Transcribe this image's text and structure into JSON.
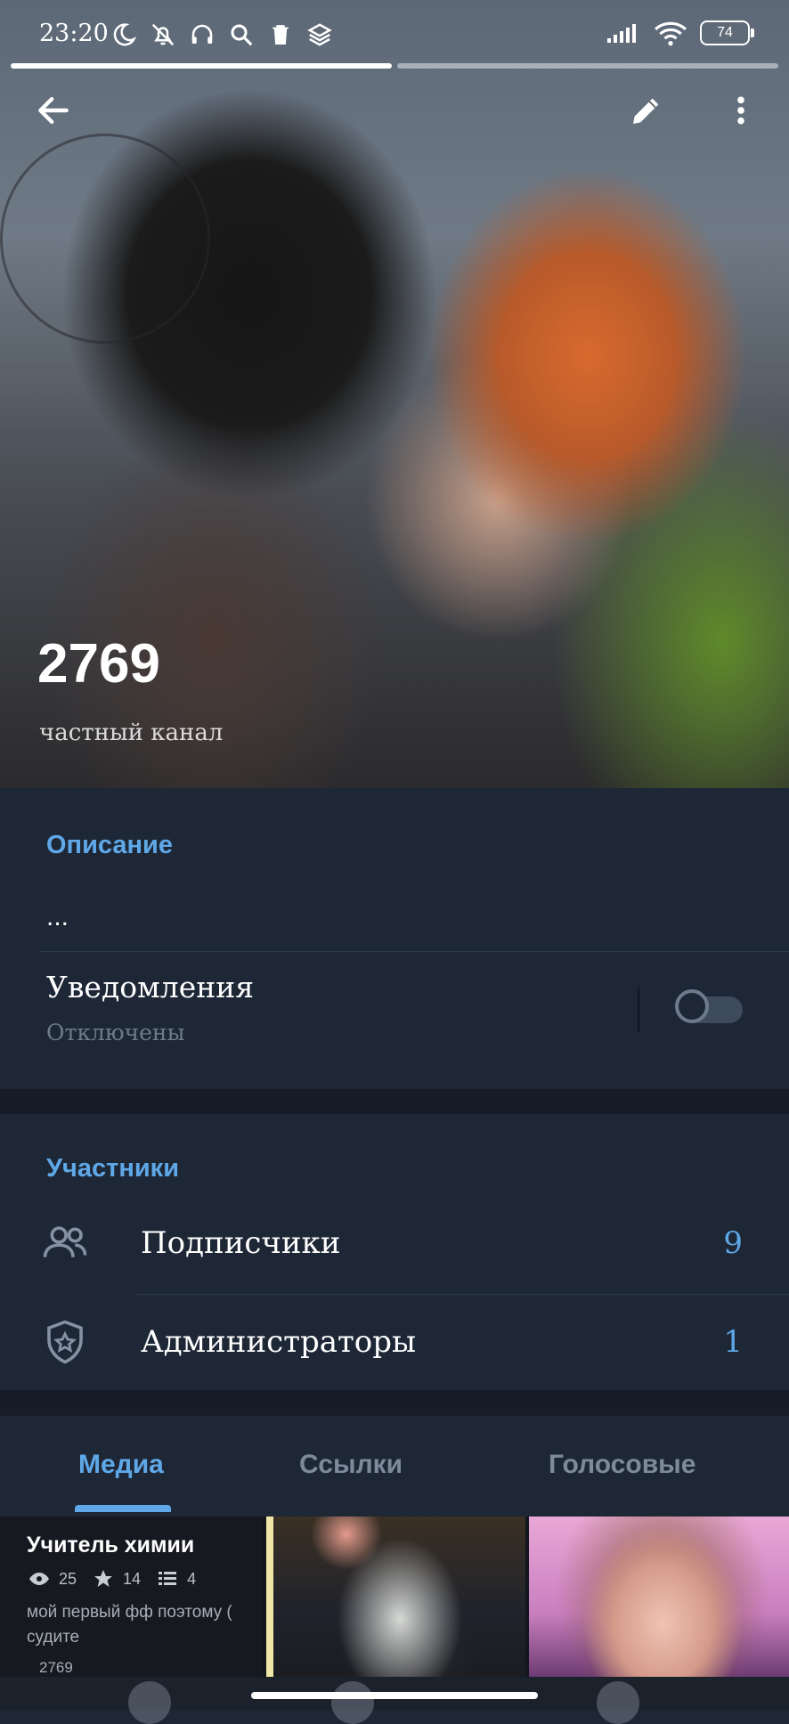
{
  "status_bar": {
    "time": "23:20",
    "battery": "74"
  },
  "header": {
    "channel_name": "2769",
    "channel_type": "частный канал"
  },
  "info": {
    "description_title": "Описание",
    "description_text": "...",
    "notifications_label": "Уведомления",
    "notifications_state": "Отключены",
    "notifications_enabled": false
  },
  "members": {
    "title": "Участники",
    "subscribers_label": "Подписчики",
    "subscribers_count": "9",
    "admins_label": "Администраторы",
    "admins_count": "1"
  },
  "tabs": [
    {
      "label": "Медиа",
      "active": true
    },
    {
      "label": "Ссылки",
      "active": false
    },
    {
      "label": "Голосовые",
      "active": false
    }
  ],
  "media": {
    "post": {
      "title": "Учитель химии",
      "views": "25",
      "stars": "14",
      "parts": "4",
      "text": "мой первый фф поэтому (",
      "text2": "судите",
      "channel": "2769"
    }
  },
  "colors": {
    "accent": "#5fa8e8",
    "background": "#1e2736"
  }
}
